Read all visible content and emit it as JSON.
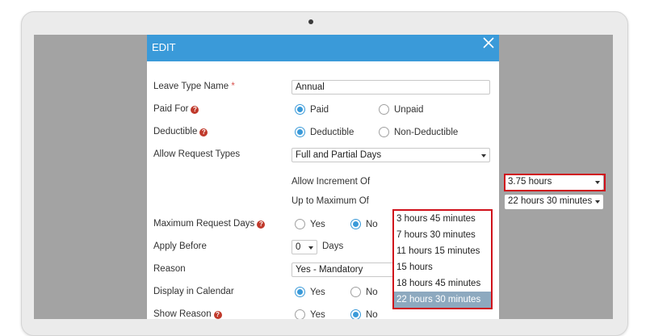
{
  "modal": {
    "title": "EDIT"
  },
  "form": {
    "leave_type_name": {
      "label": "Leave Type Name",
      "required_mark": "*",
      "value": "Annual"
    },
    "paid_for": {
      "label": "Paid For",
      "help": "?",
      "options": [
        "Paid",
        "Unpaid"
      ],
      "selected": "Paid"
    },
    "deductible": {
      "label": "Deductible",
      "help": "?",
      "options": [
        "Deductible",
        "Non-Deductible"
      ],
      "selected": "Deductible"
    },
    "allow_request_types": {
      "label": "Allow Request Types",
      "value": "Full and Partial Days"
    },
    "allow_increment": {
      "label": "Allow Increment Of",
      "value": "3.75 hours"
    },
    "up_to_maximum": {
      "label": "Up to Maximum Of",
      "value": "22 hours 30 minutes",
      "options": [
        "3 hours 45 minutes",
        "7 hours 30 minutes",
        "11 hours 15 minutes",
        "15 hours",
        "18 hours 45 minutes",
        "22 hours 30 minutes"
      ],
      "selected": "22 hours 30 minutes"
    },
    "maximum_request_days": {
      "label": "Maximum Request Days",
      "help": "?",
      "options": [
        "Yes",
        "No"
      ],
      "selected": "No"
    },
    "apply_before": {
      "label": "Apply Before",
      "value": "0",
      "unit": "Days"
    },
    "reason": {
      "label": "Reason",
      "value": "Yes - Mandatory"
    },
    "display_in_calendar": {
      "label": "Display in Calendar",
      "options": [
        "Yes",
        "No"
      ],
      "selected": "Yes"
    },
    "show_reason": {
      "label": "Show Reason",
      "help": "?",
      "options": [
        "Yes",
        "No"
      ],
      "selected": "No"
    }
  },
  "colors": {
    "header": "#3a9ad9",
    "radio_active": "#3a9ad9",
    "highlight": "#d0101b",
    "option_selected": "#8da9bf"
  }
}
